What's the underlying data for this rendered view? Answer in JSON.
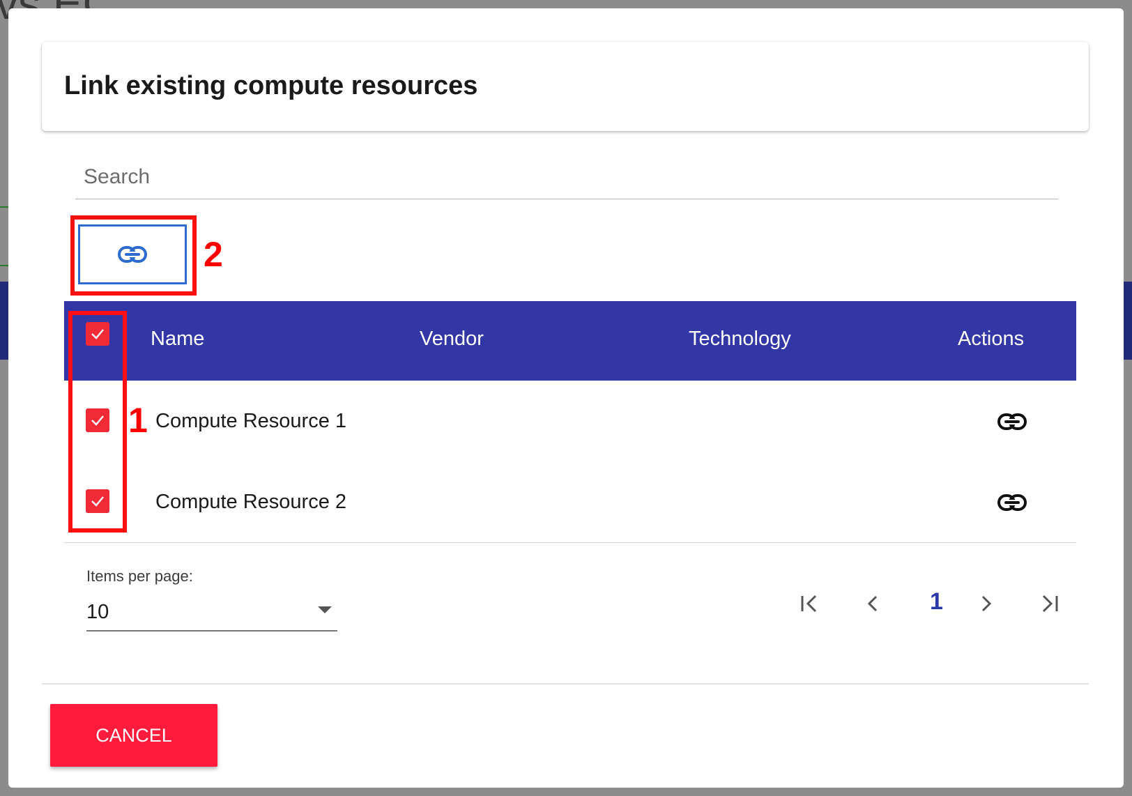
{
  "background": {
    "partial_title": "vs EC"
  },
  "dialog": {
    "title": "Link existing compute resources",
    "search": {
      "placeholder": "Search",
      "value": ""
    },
    "toolbar": {
      "link_icon": "link-icon"
    },
    "table": {
      "select_all_checked": true,
      "headers": [
        "Name",
        "Vendor",
        "Technology",
        "Actions"
      ],
      "rows": [
        {
          "name": "Compute Resource 1",
          "vendor": "",
          "technology": "",
          "checked": true,
          "action_icon": "link-icon"
        },
        {
          "name": "Compute Resource 2",
          "vendor": "",
          "technology": "",
          "checked": true,
          "action_icon": "link-icon"
        }
      ]
    },
    "pagination": {
      "items_per_page_label": "Items per page:",
      "items_per_page": "10",
      "current_page": "1",
      "icons": [
        "first-page-icon",
        "prev-page-icon",
        "next-page-icon",
        "last-page-icon"
      ]
    },
    "cancel_label": "CANCEL"
  },
  "annotations": {
    "label_1": "1",
    "label_2": "2",
    "color": "#ff0000"
  },
  "colors": {
    "header_bg": "#3337a6",
    "checkbox": "#f12b36",
    "cancel_button": "#ff1b3c",
    "link_button_border": "#2d6bd0"
  }
}
